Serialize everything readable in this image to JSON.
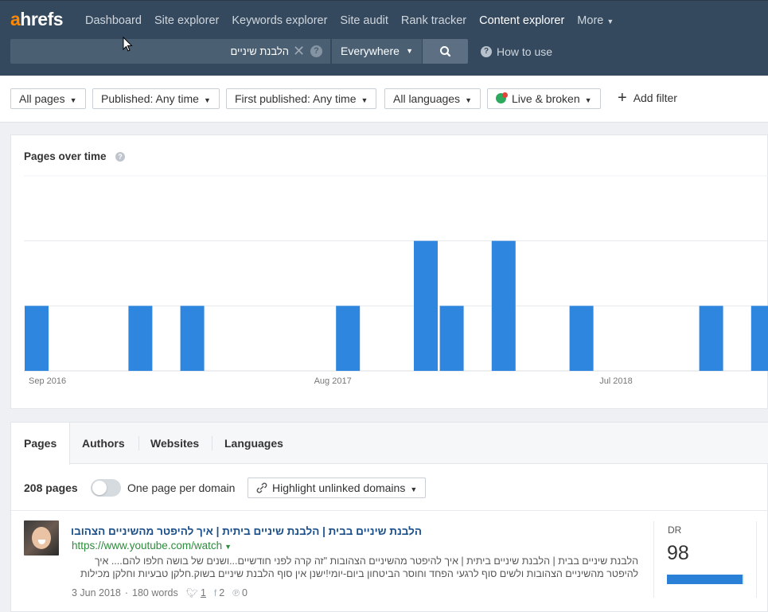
{
  "app": {
    "logo_accent": "a",
    "logo_rest": "hrefs"
  },
  "nav": {
    "items": [
      {
        "label": "Dashboard",
        "active": false
      },
      {
        "label": "Site explorer",
        "active": false
      },
      {
        "label": "Keywords explorer",
        "active": false
      },
      {
        "label": "Site audit",
        "active": false
      },
      {
        "label": "Rank tracker",
        "active": false
      },
      {
        "label": "Content explorer",
        "active": true
      },
      {
        "label": "More",
        "active": false
      }
    ]
  },
  "search": {
    "value": "הלבנת שיניים",
    "mode": "Everywhere",
    "how_to": "How to use"
  },
  "filters": {
    "pages": "All pages",
    "published": "Published: Any time",
    "first_published": "First published: Any time",
    "languages": "All languages",
    "live": "Live & broken",
    "add": "Add filter"
  },
  "chart": {
    "title": "Pages over time"
  },
  "chart_data": {
    "type": "bar",
    "title": "Pages over time",
    "x_tick_labels": [
      "Sep 2016",
      "Aug 2017",
      "Jul 2018"
    ],
    "categories": [
      "Sep 2016",
      "Oct 2016",
      "Nov 2016",
      "Dec 2016",
      "Jan 2017",
      "Feb 2017",
      "Mar 2017",
      "Apr 2017",
      "May 2017",
      "Jun 2017",
      "Jul 2017",
      "Aug 2017",
      "Sep 2017",
      "Oct 2017",
      "Nov 2017",
      "Dec 2017",
      "Jan 2018",
      "Feb 2018",
      "Mar 2018",
      "Apr 2018",
      "May 2018",
      "Jun 2018",
      "Jul 2018",
      "Aug 2018",
      "Sep 2018",
      "Oct 2018",
      "Nov 2018",
      "Dec 2018",
      "Jan 2019"
    ],
    "values": [
      2,
      0,
      0,
      0,
      2,
      0,
      2,
      0,
      0,
      0,
      0,
      0,
      2,
      0,
      0,
      4,
      2,
      0,
      4,
      0,
      0,
      2,
      0,
      0,
      0,
      0,
      2,
      0,
      2
    ],
    "ylim": [
      0,
      6
    ],
    "grid": true,
    "colors": {
      "bar": "#2e86de",
      "grid": "#e6e9ec"
    }
  },
  "results": {
    "tabs": [
      "Pages",
      "Authors",
      "Websites",
      "Languages"
    ],
    "count": "208 pages",
    "toggle_label": "One page per domain",
    "highlight": "Highlight unlinked domains",
    "items": [
      {
        "title": "הלבנת שיניים בבית | הלבנת שיניים ביתית | איך להיפטר מהשיניים הצהובות",
        "url": "https://www.youtube.com/watch",
        "snippet": "הלבנת שיניים בבית | הלבנת שיניים ביתית | איך להיפטר מהשיניים הצהובות \"זה קרה לפני חודשיים...ושנים של בושה חלפו להם.... איך להיפטר מהשיניים הצהובות ולשים סוף לרגעי הפחד וחוסר הביטחון ביום-יומי!ישנן אין סוף הלבנת שיניים בשוק.חלקן טבעיות וחלקן מכילות",
        "date": "3 Jun 2018",
        "words": "180 words",
        "twitter": "1",
        "facebook": "2",
        "pinterest": "0",
        "dr_label": "DR",
        "dr": "98",
        "dr_value": 98
      }
    ]
  }
}
